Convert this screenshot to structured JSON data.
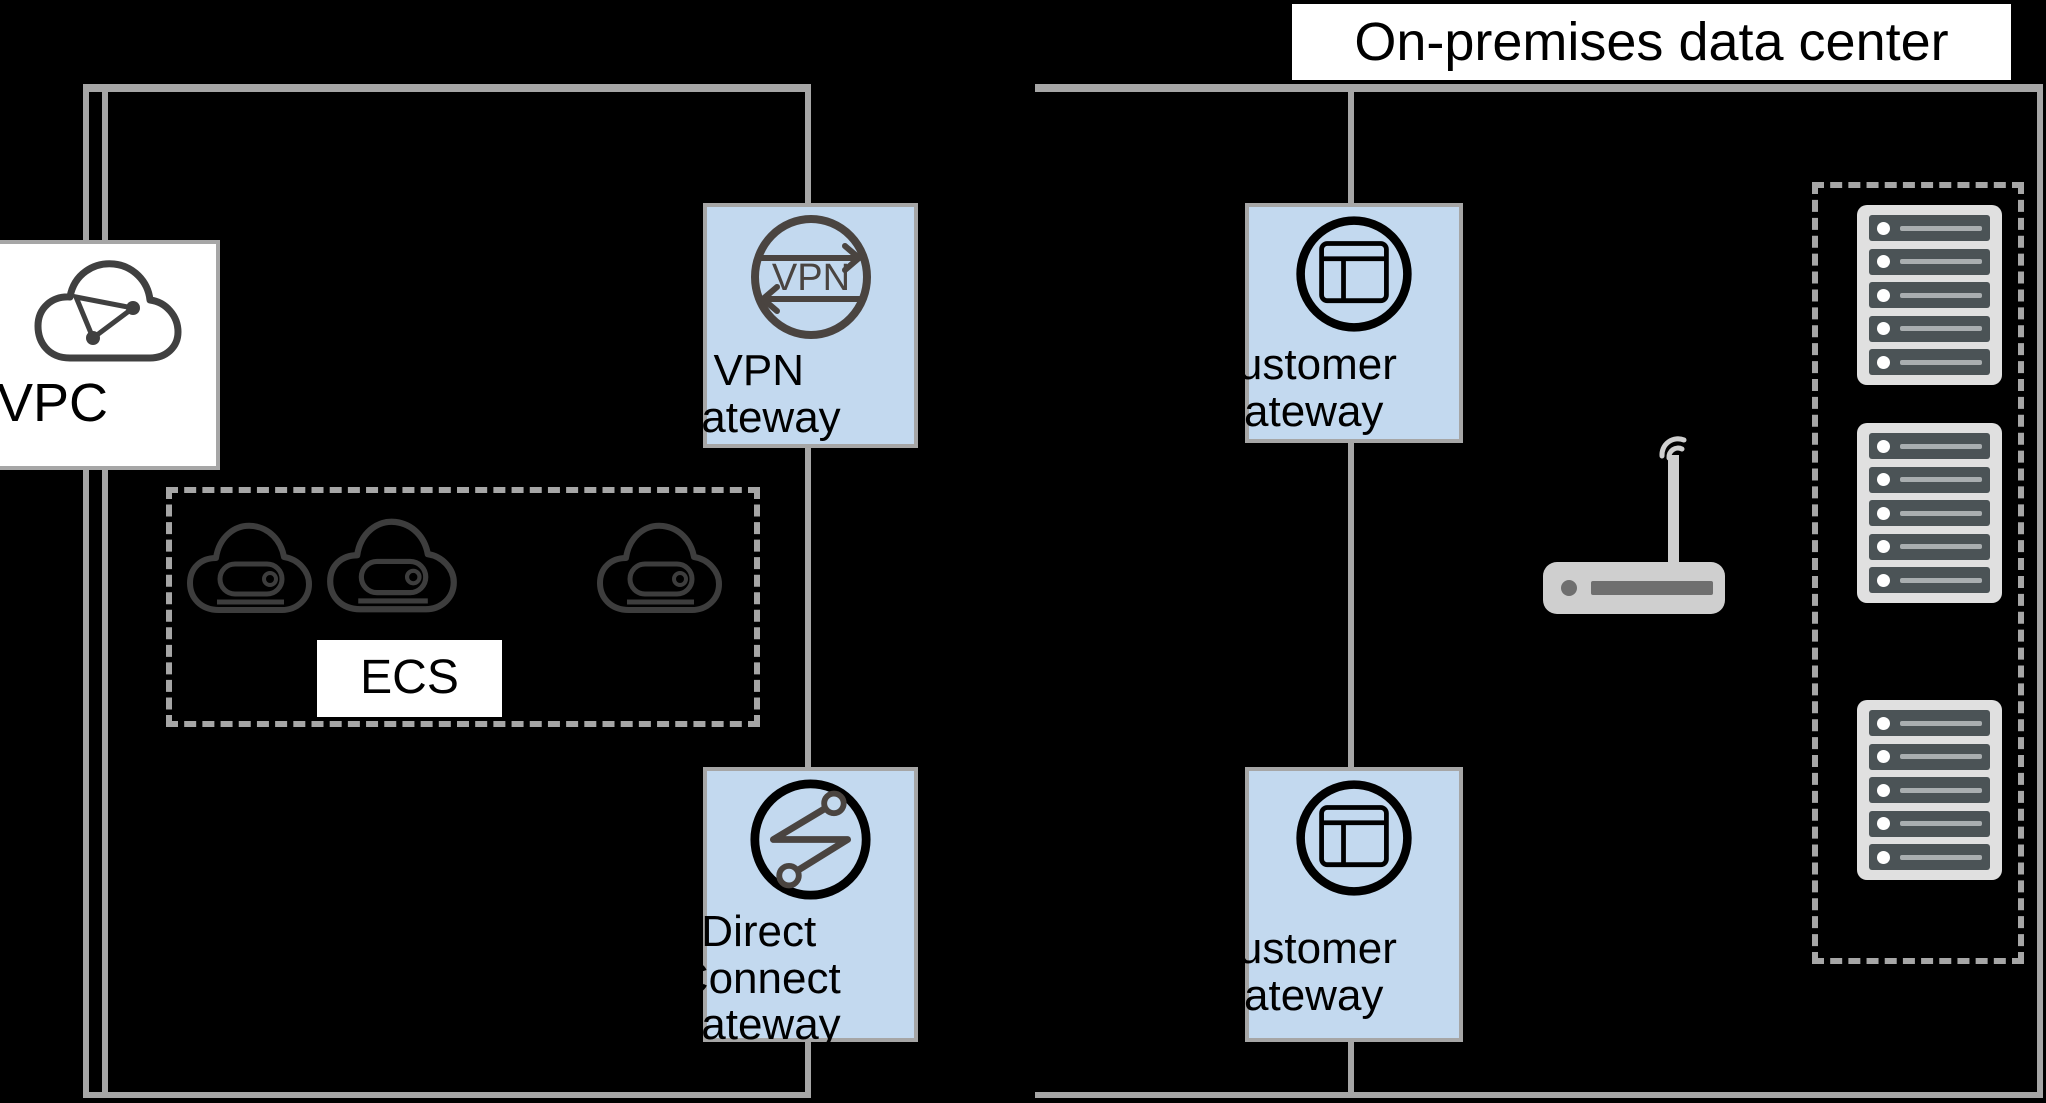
{
  "diagram": {
    "title": "On-premises data center",
    "background_color": "#000000",
    "line_color": "#a6a6a6",
    "node_fill_blue": "#c3d9ef",
    "node_fill_white": "#ffffff",
    "icon_color": "#404040",
    "rack_color": "#4b5356"
  },
  "regions": [
    {
      "id": "cloud-region",
      "label": ""
    },
    {
      "id": "onprem-region",
      "label": "On-premises data center"
    }
  ],
  "nodes": {
    "vpc": {
      "label": "VPC",
      "icon": "cloud-vpc-icon",
      "fill": "#ffffff"
    },
    "vpn_gateway": {
      "label": "VPN\ngateway",
      "icon": "vpn-icon",
      "icon_text": "VPN",
      "fill": "#c3d9ef"
    },
    "direct_connect_gateway": {
      "label": "Direct\nConnect\ngateway",
      "icon": "direct-connect-icon",
      "fill": "#c3d9ef"
    },
    "customer_gateway_top": {
      "label": "Customer\ngateway",
      "icon": "customer-gateway-icon",
      "fill": "#c3d9ef"
    },
    "customer_gateway_bottom": {
      "label": "Customer\ngateway",
      "icon": "customer-gateway-icon",
      "fill": "#c3d9ef"
    }
  },
  "groups": {
    "ecs": {
      "label": "ECS",
      "icon": "cloud-server-icon",
      "instance_count": 3
    },
    "server_racks": {
      "label": "",
      "rack_count": 3,
      "units_per_rack": 5
    }
  },
  "devices": {
    "router": {
      "icon": "wifi-router-icon",
      "label": ""
    }
  }
}
